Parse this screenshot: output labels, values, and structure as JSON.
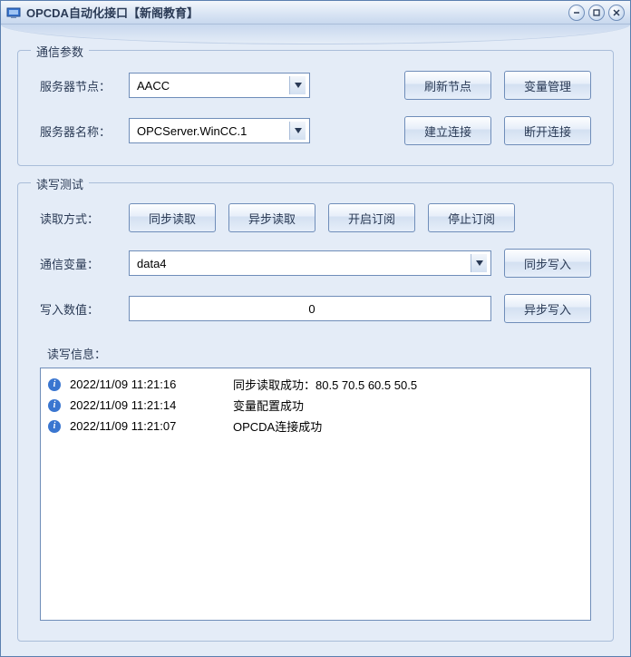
{
  "window": {
    "title": "OPCDA自动化接口【新阁教育】"
  },
  "group_comm": {
    "legend": "通信参数",
    "server_node_label": "服务器节点：",
    "server_node_value": "AACC",
    "server_name_label": "服务器名称：",
    "server_name_value": "OPCServer.WinCC.1",
    "btn_refresh": "刷新节点",
    "btn_varmgr": "变量管理",
    "btn_connect": "建立连接",
    "btn_disconnect": "断开连接"
  },
  "group_rw": {
    "legend": "读写测试",
    "read_mode_label": "读取方式：",
    "btn_sync_read": "同步读取",
    "btn_async_read": "异步读取",
    "btn_subscribe": "开启订阅",
    "btn_unsubscribe": "停止订阅",
    "comm_var_label": "通信变量：",
    "comm_var_value": "data4",
    "btn_sync_write": "同步写入",
    "write_value_label": "写入数值：",
    "write_value": "0",
    "btn_async_write": "异步写入",
    "log_label": "读写信息：",
    "logs": [
      {
        "time": "2022/11/09 11:21:16",
        "msg": "同步读取成功：80.5 70.5 60.5 50.5"
      },
      {
        "time": "2022/11/09 11:21:14",
        "msg": "变量配置成功"
      },
      {
        "time": "2022/11/09 11:21:07",
        "msg": "OPCDA连接成功"
      }
    ]
  }
}
